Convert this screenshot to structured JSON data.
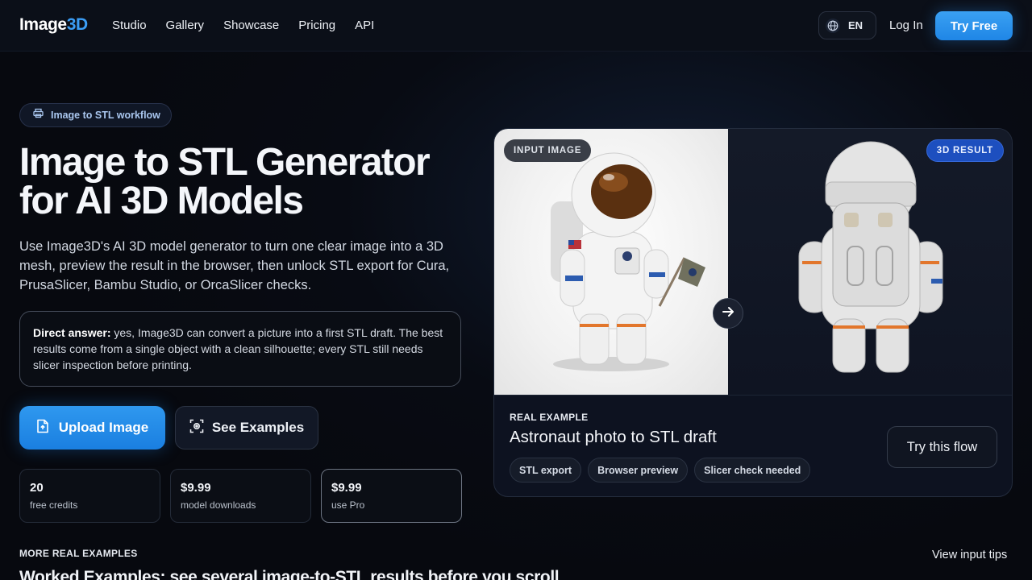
{
  "nav": {
    "logo_text": "Image",
    "logo_accent": "3D",
    "links": [
      "Studio",
      "Gallery",
      "Showcase",
      "Pricing",
      "API"
    ],
    "lang": "EN",
    "login": "Log In",
    "cta": "Try Free"
  },
  "hero": {
    "pill": "Image to STL workflow",
    "title_line1": "Image to STL Generator",
    "title_line2": "for AI 3D Models",
    "lead": "Use Image3D's AI 3D model generator to turn one clear image into a 3D mesh, preview the result in the browser, then unlock STL export for Cura, PrusaSlicer, Bambu Studio, or OrcaSlicer checks.",
    "answer_label": "Direct answer:",
    "answer_text": " yes, Image3D can convert a picture into a first STL draft. The best results come from a single object with a clean silhouette; every STL still needs slicer inspection before printing.",
    "upload_label": "Upload Image",
    "examples_label": "See Examples",
    "stats": [
      {
        "value": "20",
        "label": "free credits"
      },
      {
        "value": "$9.99",
        "label": "model downloads"
      },
      {
        "value": "$9.99",
        "label": "use Pro"
      }
    ]
  },
  "card": {
    "input_tag": "INPUT IMAGE",
    "result_tag": "3D RESULT",
    "eyebrow": "REAL EXAMPLE",
    "title": "Astronaut photo to STL draft",
    "chips": [
      "STL export",
      "Browser preview",
      "Slicer check needed"
    ],
    "cta": "Try this flow"
  },
  "more": {
    "eyebrow": "MORE REAL EXAMPLES",
    "tips": "View input tips",
    "heading": "Worked Examples: see several image-to-STL results before you scroll"
  },
  "colors": {
    "background": "#07090f",
    "accent": "#2f98ef",
    "result_tag": "#1d4fbf"
  }
}
